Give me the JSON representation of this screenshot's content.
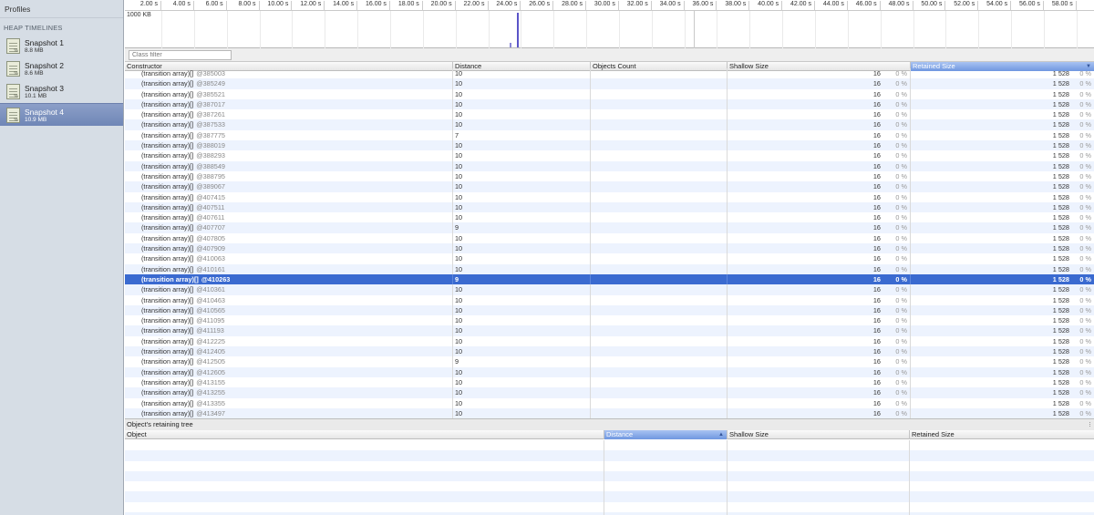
{
  "sidebar": {
    "title": "Profiles",
    "section": "HEAP TIMELINES",
    "snapshots": [
      {
        "name": "Snapshot 1",
        "size": "8.8 MB"
      },
      {
        "name": "Snapshot 2",
        "size": "8.6 MB"
      },
      {
        "name": "Snapshot 3",
        "size": "10.1 MB"
      },
      {
        "name": "Snapshot 4",
        "size": "10.9 MB"
      }
    ],
    "selected_index": 3
  },
  "timeline": {
    "ticks": [
      "2.00 s",
      "4.00 s",
      "6.00 s",
      "8.00 s",
      "10.00 s",
      "12.00 s",
      "14.00 s",
      "16.00 s",
      "18.00 s",
      "20.00 s",
      "22.00 s",
      "24.00 s",
      "26.00 s",
      "28.00 s",
      "30.00 s",
      "32.00 s",
      "34.00 s",
      "36.00 s",
      "38.00 s",
      "40.00 s",
      "42.00 s",
      "44.00 s",
      "46.00 s",
      "48.00 s",
      "50.00 s",
      "52.00 s",
      "54.00 s",
      "56.00 s",
      "58.00 s"
    ],
    "scale_label": "1000 KB",
    "spike_color": "#5a54c8"
  },
  "filter": {
    "placeholder": "Class filter"
  },
  "grid": {
    "columns": {
      "constructor": "Constructor",
      "distance": "Distance",
      "objects_count": "Objects Count",
      "shallow_size": "Shallow Size",
      "retained_size": "Retained Size"
    },
    "sorted_column": "retained_size",
    "rows": [
      {
        "name": "(transition array)[]",
        "id": "@385003",
        "distance": "10",
        "shallow": "16",
        "sp": "0 %",
        "retained": "1 528",
        "rp": "0 %"
      },
      {
        "name": "(transition array)[]",
        "id": "@385249",
        "distance": "10",
        "shallow": "16",
        "sp": "0 %",
        "retained": "1 528",
        "rp": "0 %"
      },
      {
        "name": "(transition array)[]",
        "id": "@385521",
        "distance": "10",
        "shallow": "16",
        "sp": "0 %",
        "retained": "1 528",
        "rp": "0 %"
      },
      {
        "name": "(transition array)[]",
        "id": "@387017",
        "distance": "10",
        "shallow": "16",
        "sp": "0 %",
        "retained": "1 528",
        "rp": "0 %"
      },
      {
        "name": "(transition array)[]",
        "id": "@387261",
        "distance": "10",
        "shallow": "16",
        "sp": "0 %",
        "retained": "1 528",
        "rp": "0 %"
      },
      {
        "name": "(transition array)[]",
        "id": "@387533",
        "distance": "10",
        "shallow": "16",
        "sp": "0 %",
        "retained": "1 528",
        "rp": "0 %"
      },
      {
        "name": "(transition array)[]",
        "id": "@387775",
        "distance": "7",
        "shallow": "16",
        "sp": "0 %",
        "retained": "1 528",
        "rp": "0 %"
      },
      {
        "name": "(transition array)[]",
        "id": "@388019",
        "distance": "10",
        "shallow": "16",
        "sp": "0 %",
        "retained": "1 528",
        "rp": "0 %"
      },
      {
        "name": "(transition array)[]",
        "id": "@388293",
        "distance": "10",
        "shallow": "16",
        "sp": "0 %",
        "retained": "1 528",
        "rp": "0 %"
      },
      {
        "name": "(transition array)[]",
        "id": "@388549",
        "distance": "10",
        "shallow": "16",
        "sp": "0 %",
        "retained": "1 528",
        "rp": "0 %"
      },
      {
        "name": "(transition array)[]",
        "id": "@388795",
        "distance": "10",
        "shallow": "16",
        "sp": "0 %",
        "retained": "1 528",
        "rp": "0 %"
      },
      {
        "name": "(transition array)[]",
        "id": "@389067",
        "distance": "10",
        "shallow": "16",
        "sp": "0 %",
        "retained": "1 528",
        "rp": "0 %"
      },
      {
        "name": "(transition array)[]",
        "id": "@407415",
        "distance": "10",
        "shallow": "16",
        "sp": "0 %",
        "retained": "1 528",
        "rp": "0 %"
      },
      {
        "name": "(transition array)[]",
        "id": "@407511",
        "distance": "10",
        "shallow": "16",
        "sp": "0 %",
        "retained": "1 528",
        "rp": "0 %"
      },
      {
        "name": "(transition array)[]",
        "id": "@407611",
        "distance": "10",
        "shallow": "16",
        "sp": "0 %",
        "retained": "1 528",
        "rp": "0 %"
      },
      {
        "name": "(transition array)[]",
        "id": "@407707",
        "distance": "9",
        "shallow": "16",
        "sp": "0 %",
        "retained": "1 528",
        "rp": "0 %"
      },
      {
        "name": "(transition array)[]",
        "id": "@407805",
        "distance": "10",
        "shallow": "16",
        "sp": "0 %",
        "retained": "1 528",
        "rp": "0 %"
      },
      {
        "name": "(transition array)[]",
        "id": "@407909",
        "distance": "10",
        "shallow": "16",
        "sp": "0 %",
        "retained": "1 528",
        "rp": "0 %"
      },
      {
        "name": "(transition array)[]",
        "id": "@410063",
        "distance": "10",
        "shallow": "16",
        "sp": "0 %",
        "retained": "1 528",
        "rp": "0 %"
      },
      {
        "name": "(transition array)[]",
        "id": "@410161",
        "distance": "10",
        "shallow": "16",
        "sp": "0 %",
        "retained": "1 528",
        "rp": "0 %"
      },
      {
        "name": "(transition array)[]",
        "id": "@410263",
        "distance": "9",
        "shallow": "16",
        "sp": "0 %",
        "retained": "1 528",
        "rp": "0 %",
        "selected": true
      },
      {
        "name": "(transition array)[]",
        "id": "@410361",
        "distance": "10",
        "shallow": "16",
        "sp": "0 %",
        "retained": "1 528",
        "rp": "0 %"
      },
      {
        "name": "(transition array)[]",
        "id": "@410463",
        "distance": "10",
        "shallow": "16",
        "sp": "0 %",
        "retained": "1 528",
        "rp": "0 %"
      },
      {
        "name": "(transition array)[]",
        "id": "@410565",
        "distance": "10",
        "shallow": "16",
        "sp": "0 %",
        "retained": "1 528",
        "rp": "0 %"
      },
      {
        "name": "(transition array)[]",
        "id": "@411095",
        "distance": "10",
        "shallow": "16",
        "sp": "0 %",
        "retained": "1 528",
        "rp": "0 %"
      },
      {
        "name": "(transition array)[]",
        "id": "@411193",
        "distance": "10",
        "shallow": "16",
        "sp": "0 %",
        "retained": "1 528",
        "rp": "0 %"
      },
      {
        "name": "(transition array)[]",
        "id": "@412225",
        "distance": "10",
        "shallow": "16",
        "sp": "0 %",
        "retained": "1 528",
        "rp": "0 %"
      },
      {
        "name": "(transition array)[]",
        "id": "@412405",
        "distance": "10",
        "shallow": "16",
        "sp": "0 %",
        "retained": "1 528",
        "rp": "0 %"
      },
      {
        "name": "(transition array)[]",
        "id": "@412505",
        "distance": "9",
        "shallow": "16",
        "sp": "0 %",
        "retained": "1 528",
        "rp": "0 %"
      },
      {
        "name": "(transition array)[]",
        "id": "@412605",
        "distance": "10",
        "shallow": "16",
        "sp": "0 %",
        "retained": "1 528",
        "rp": "0 %"
      },
      {
        "name": "(transition array)[]",
        "id": "@413155",
        "distance": "10",
        "shallow": "16",
        "sp": "0 %",
        "retained": "1 528",
        "rp": "0 %"
      },
      {
        "name": "(transition array)[]",
        "id": "@413255",
        "distance": "10",
        "shallow": "16",
        "sp": "0 %",
        "retained": "1 528",
        "rp": "0 %"
      },
      {
        "name": "(transition array)[]",
        "id": "@413355",
        "distance": "10",
        "shallow": "16",
        "sp": "0 %",
        "retained": "1 528",
        "rp": "0 %"
      },
      {
        "name": "(transition array)[]",
        "id": "@413497",
        "distance": "10",
        "shallow": "16",
        "sp": "0 %",
        "retained": "1 528",
        "rp": "0 %"
      }
    ]
  },
  "retaining": {
    "title": "Object's retaining tree",
    "columns": {
      "object": "Object",
      "distance": "Distance",
      "shallow_size": "Shallow Size",
      "retained_size": "Retained Size"
    },
    "sorted_column": "distance",
    "empty_rows": 8
  },
  "colors": {
    "selection": "#3a6ad0",
    "stripe": "#edf3fe",
    "sidebar": "#d6dde5"
  }
}
